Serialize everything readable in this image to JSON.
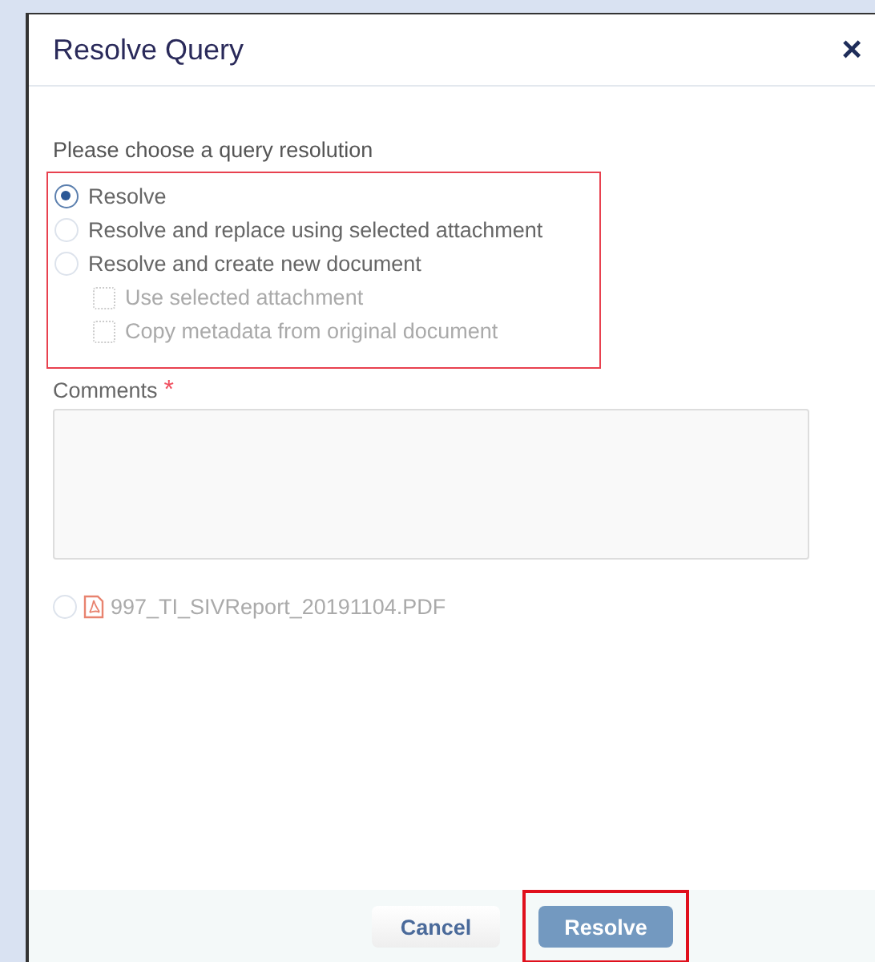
{
  "dialog": {
    "title": "Resolve Query",
    "close": "×"
  },
  "prompt": "Please choose a query resolution",
  "options": [
    {
      "label": "Resolve",
      "selected": true
    },
    {
      "label": "Resolve and replace using selected attachment",
      "selected": false
    },
    {
      "label": "Resolve and create new document",
      "selected": false
    }
  ],
  "suboptions": [
    {
      "label": "Use selected attachment",
      "checked": false,
      "disabled": true
    },
    {
      "label": "Copy metadata from original document",
      "checked": false,
      "disabled": true
    }
  ],
  "comments": {
    "label": "Comments",
    "required_mark": "*"
  },
  "attachments": [
    {
      "name": "997_TI_SIVReport_20191104.PDF",
      "selected": false
    }
  ],
  "buttons": [
    {
      "label": "Cancel",
      "kind": "secondary",
      "highlighted": false
    },
    {
      "label": "Resolve",
      "kind": "primary",
      "highlighted": true
    }
  ]
}
